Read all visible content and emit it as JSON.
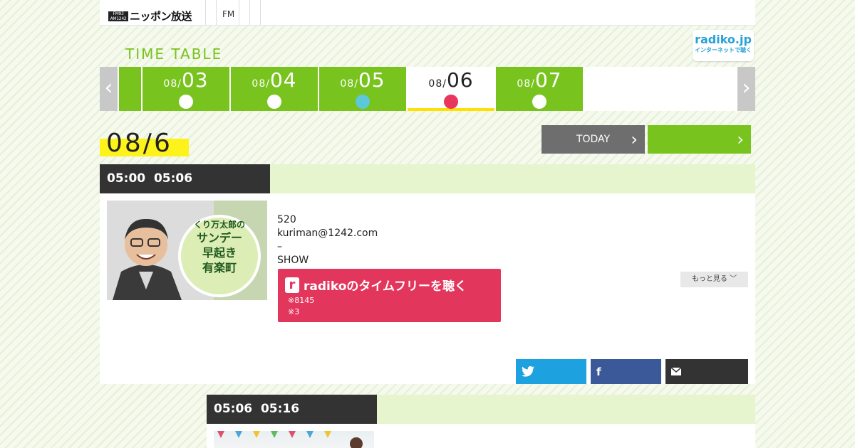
{
  "nav": {
    "logo_mark": "FM93 AM1242",
    "logo_text": "ニッポン放送",
    "items": [
      "FM"
    ]
  },
  "radiko_badge": {
    "main": "radiko.jp",
    "sub": "インターネットで聴く"
  },
  "timetable": {
    "heading": "TIME TABLE",
    "dates": [
      {
        "month": "08/",
        "day": "03",
        "dot_color": "#ffffff",
        "active": false
      },
      {
        "month": "08/",
        "day": "04",
        "dot_color": "#ffffff",
        "active": false
      },
      {
        "month": "08/",
        "day": "05",
        "dot_color": "#5cc8d8",
        "active": false
      },
      {
        "month": "08/",
        "day": "06",
        "dot_color": "#e8365d",
        "active": true
      },
      {
        "month": "08/",
        "day": "07",
        "dot_color": "#ffffff",
        "active": false
      }
    ],
    "current_date": "08/6",
    "today_label": "TODAY"
  },
  "programs": [
    {
      "time_start": "05:00",
      "time_end": "05:06",
      "thumb_caption": [
        "くり万太郎の",
        "サンデー",
        "早起き",
        "有楽町"
      ],
      "info_lines": [
        "520",
        "kuriman@1242.com",
        "–",
        "SHOW"
      ],
      "radiko_cta": {
        "logo": "r",
        "title": "radikoのタイムフリーを聴く",
        "note1": "※8145",
        "note2": "※3"
      },
      "more_label": "もっと見る"
    },
    {
      "time_start": "05:06",
      "time_end": "05:16"
    }
  ],
  "colors": {
    "brand_green": "#78c31d",
    "highlight_yellow": "#fdf31a",
    "radiko_red": "#e3365c",
    "twitter": "#1da1df",
    "facebook": "#3b5998"
  }
}
